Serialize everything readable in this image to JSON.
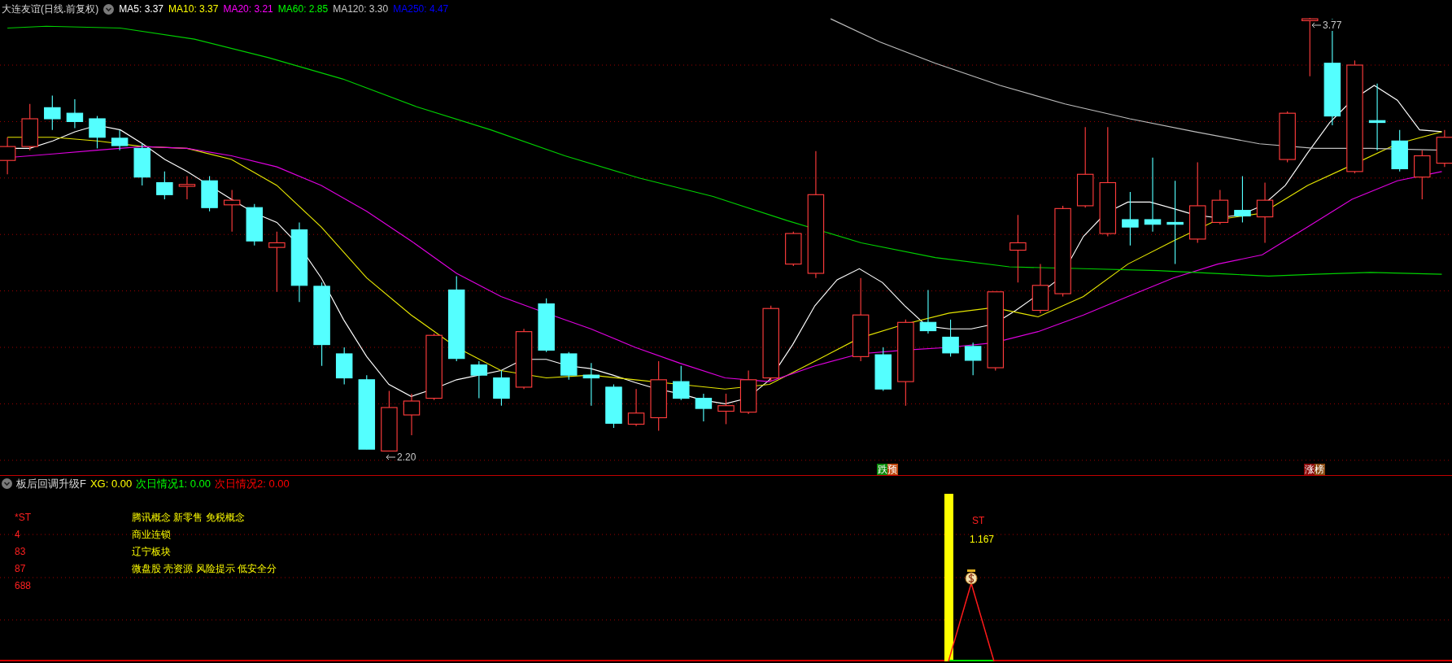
{
  "header": {
    "title": "大连友谊(日线.前复权)",
    "indicators": [
      {
        "label": "MA5: 3.37",
        "color": "#ffffff"
      },
      {
        "label": "MA10: 3.37",
        "color": "#ffff00"
      },
      {
        "label": "MA20: 3.21",
        "color": "#ff00ff"
      },
      {
        "label": "MA60: 2.85",
        "color": "#00ff00"
      },
      {
        "label": "MA120: 3.30",
        "color": "#c8c8c8"
      },
      {
        "label": "MA250: 4.47",
        "color": "#0000ff"
      }
    ]
  },
  "main_chart": {
    "high_label": "3.77",
    "low_label": "2.20",
    "signals": [
      {
        "label": "跌预",
        "kind": "fall"
      },
      {
        "label": "涨榜",
        "kind": "rise"
      }
    ]
  },
  "sub_header": {
    "title": "板后回调升级F",
    "values": [
      {
        "label": "XG: 0.00",
        "color": "#ffff00"
      },
      {
        "label": "次日情况1: 0.00",
        "color": "#00ff00"
      },
      {
        "label": "次日情况2: 0.00",
        "color": "#ff0000"
      }
    ]
  },
  "sub_panel": {
    "codes": [
      "*ST",
      "4",
      "83",
      "87",
      "688"
    ],
    "concepts": [
      "腾讯概念 新零售 免税概念",
      "商业连锁",
      "辽宁板块",
      "微盘股 壳资源 风险提示 低安全分"
    ],
    "marker_label": "ST",
    "marker_value": "1.167"
  }
}
